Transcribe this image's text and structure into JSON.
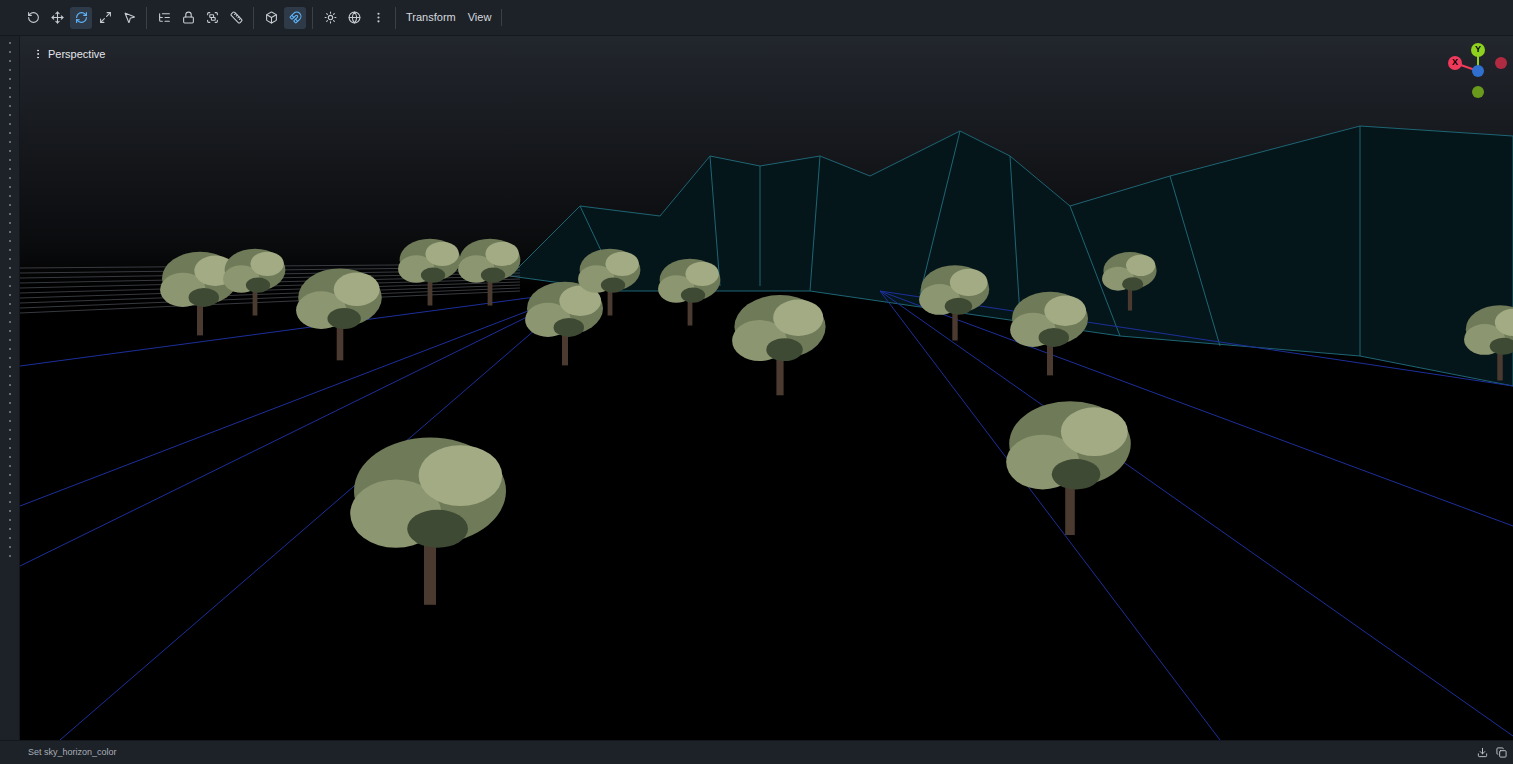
{
  "toolbar": {
    "groups": [
      [
        {
          "selected": false
        },
        {
          "selected": false
        },
        {
          "selected": true
        },
        {
          "selected": false
        },
        {
          "selected": false
        }
      ],
      [
        {
          "selected": false
        },
        {
          "selected": false
        },
        {
          "selected": false
        },
        {
          "selected": false
        }
      ],
      [
        {
          "selected": false
        },
        {
          "selected": true
        }
      ],
      [
        {
          "selected": false
        },
        {
          "selected": false
        },
        {
          "selected": false
        }
      ]
    ],
    "menus": [
      {
        "label": "Transform"
      },
      {
        "label": "View"
      }
    ]
  },
  "viewport": {
    "label": "Perspective"
  },
  "gizmo": {
    "axes": [
      {
        "label": "Y",
        "color": "#8fd11f"
      },
      {
        "label": "X",
        "color": "#f03a5c"
      }
    ]
  },
  "output": {
    "lines": [
      "Set sky_horizon_color"
    ]
  }
}
